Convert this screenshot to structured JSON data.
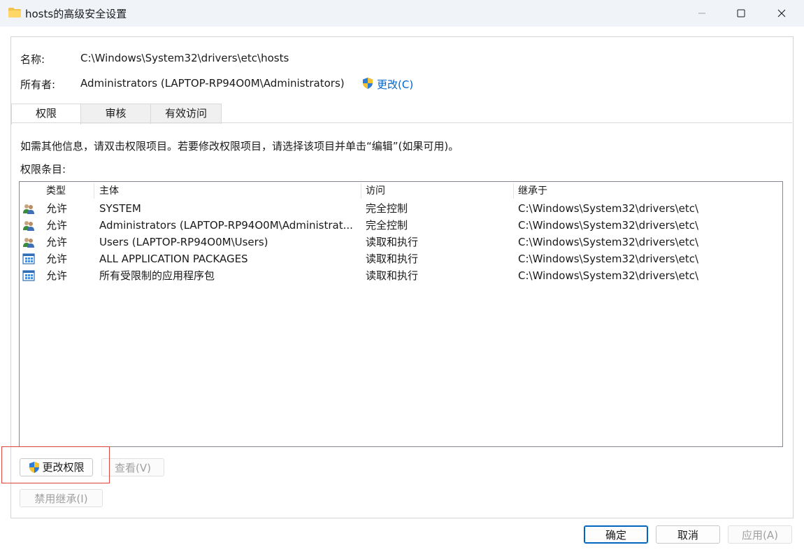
{
  "window": {
    "title": "hosts的高级安全设置",
    "icon": "folder-icon"
  },
  "name_label": "名称:",
  "name_value": "C:\\Windows\\System32\\drivers\\etc\\hosts",
  "owner_label": "所有者:",
  "owner_value": "Administrators (LAPTOP-RP94O0M\\Administrators)",
  "owner_change_link": "更改(C)",
  "tabs": [
    {
      "label": "权限",
      "active": true
    },
    {
      "label": "审核",
      "active": false
    },
    {
      "label": "有效访问",
      "active": false
    }
  ],
  "info_text": "如需其他信息，请双击权限项目。若要修改权限项目，请选择该项目并单击“编辑”(如果可用)。",
  "entries_label": "权限条目:",
  "columns": [
    "类型",
    "主体",
    "访问",
    "继承于"
  ],
  "rows": [
    {
      "icon": "users-group-icon",
      "type": "允许",
      "principal": "SYSTEM",
      "access": "完全控制",
      "inherited": "C:\\Windows\\System32\\drivers\\etc\\"
    },
    {
      "icon": "users-group-icon",
      "type": "允许",
      "principal": "Administrators (LAPTOP-RP94O0M\\Administrat...",
      "access": "完全控制",
      "inherited": "C:\\Windows\\System32\\drivers\\etc\\"
    },
    {
      "icon": "users-group-icon",
      "type": "允许",
      "principal": "Users (LAPTOP-RP94O0M\\Users)",
      "access": "读取和执行",
      "inherited": "C:\\Windows\\System32\\drivers\\etc\\"
    },
    {
      "icon": "app-package-icon",
      "type": "允许",
      "principal": "ALL APPLICATION PACKAGES",
      "access": "读取和执行",
      "inherited": "C:\\Windows\\System32\\drivers\\etc\\"
    },
    {
      "icon": "app-package-icon",
      "type": "允许",
      "principal": "所有受限制的应用程序包",
      "access": "读取和执行",
      "inherited": "C:\\Windows\\System32\\drivers\\etc\\"
    }
  ],
  "buttons": {
    "change_permissions": "更改权限",
    "view": "查看(V)",
    "disable_inheritance": "禁用继承(I)",
    "ok": "确定",
    "cancel": "取消",
    "apply": "应用(A)"
  },
  "colors": {
    "accent": "#0067c0",
    "link": "#0066cc",
    "highlight_box": "#e0453c",
    "titlebar": "#f0f4f9"
  }
}
